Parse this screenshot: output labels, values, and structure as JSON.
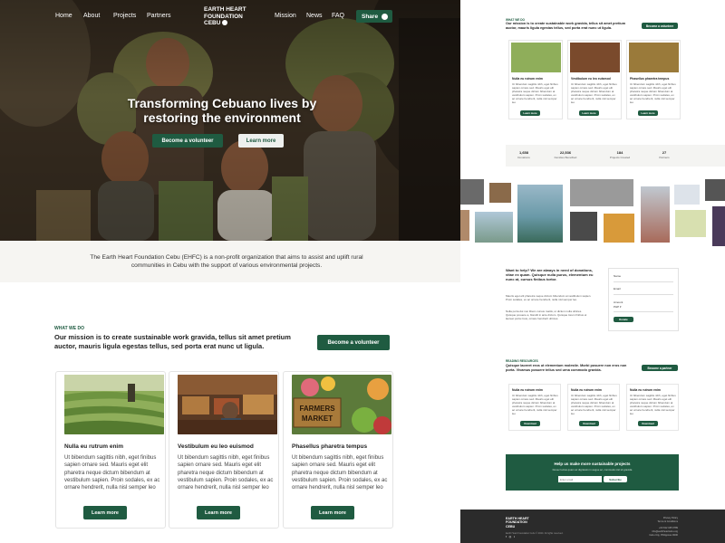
{
  "colors": {
    "brand_green": "#1f5b41",
    "footer_bg": "#2b2b2b",
    "about_bg": "#f6f5f2"
  },
  "nav": {
    "items": [
      "Home",
      "About",
      "Projects",
      "Partners",
      "Mission",
      "News",
      "FAQ"
    ],
    "logo": [
      "EARTH HEART",
      "FOUNDATION",
      "CEBU"
    ],
    "share": "Share",
    "share_icon": "share-icon"
  },
  "hero": {
    "title": "Transforming Cebuano lives by restoring the environment",
    "volunteer": "Become a volunteer",
    "learn": "Learn more"
  },
  "about": {
    "text": "The Earth Heart Foundation Cebu (EHFC) is a non-profit organization that aims to assist and uplift rural communities in Cebu with the support of various environmental projects."
  },
  "what_we_do": {
    "label": "WHAT WE DO",
    "title": "Our mission is to create sustainable work gravida, tellus sit amet pretium auctor, mauris ligula egestas tellus, sed porta erat nunc ut ligula.",
    "button": "Become a volunteer"
  },
  "cards": [
    {
      "title": "Nulla eu rutrum enim",
      "body": "Ut bibendum sagittis nibh, eget finibus sapien ornare sed. Mauris eget elit pharetra neque dictum bibendum at vestibulum sapien. Proin sodales, ex ac ornare hendrerit, nulla nisl semper leo",
      "button": "Learn more"
    },
    {
      "title": "Vestibulum eu leo euismod",
      "body": "Ut bibendum sagittis nibh, eget finibus sapien ornare sed. Mauris eget elit pharetra neque dictum bibendum at vestibulum sapien. Proin sodales, ex ac ornare hendrerit, nulla nisl semper leo",
      "button": "Learn more"
    },
    {
      "title": "Phasellus pharetra tempus",
      "body": "Ut bibendum sagittis nibh, eget finibus sapien ornare sed. Mauris eget elit pharetra neque dictum bibendum at vestibulum sapien. Proin sodales, ex ac ornare hendrerit, nulla nisl semper leo",
      "button": "Learn more",
      "sign": [
        "FARMERS",
        "MARKET"
      ]
    }
  ],
  "right": {
    "wwd_label": "WHAT WE DO",
    "wwd_title": "Our mission is to create sustainable work gravida, tellus sit amet pretium auctor, mauris ligula egestas tellus, sed porta erat nunc ut ligula.",
    "wwd_button": "Become a volunteer",
    "cards": [
      {
        "title": "Nulla eu rutrum enim",
        "body": "Ut bibendum sagittis nibh, eget finibus sapien ornare sed. Mauris eget elit pharetra neque dictum bibendum at vestibulum sapien. Proin sodales, ex ac ornare hendrerit, nulla nisl semper leo",
        "button": "Learn more"
      },
      {
        "title": "Vestibulum eu leo euismod",
        "body": "Ut bibendum sagittis nibh, eget finibus sapien ornare sed. Mauris eget elit pharetra neque dictum bibendum at vestibulum sapien. Proin sodales, ex ac ornare hendrerit, nulla nisl semper leo",
        "button": "Learn more"
      },
      {
        "title": "Phasellus pharetra tempus",
        "body": "Ut bibendum sagittis nibh, eget finibus sapien ornare sed. Mauris eget elit pharetra neque dictum bibendum at vestibulum sapien. Proin sodales, ex ac ornare hendrerit, nulla nisl semper leo",
        "button": "Learn more"
      }
    ],
    "stats": [
      {
        "value": "1,658",
        "label": "Donations"
      },
      {
        "value": "22,536",
        "label": "Families Benefited"
      },
      {
        "value": "184",
        "label": "Projects Created"
      },
      {
        "value": "27",
        "label": "Partners"
      }
    ],
    "help": {
      "title": "Want to help? We are always in need of donations, vitae ex quam. Quisque nulla purus, elementum eu nunc at, cursus finibus tortor.",
      "p1": "Mauris eget elit pharetra neque dictum bibendum at vestibulum sapien. Proin sodales, ex ac ornare hendrerit, nulla nisl semper leo.",
      "p2": "Nulla porta dui non libero cursus mattis, ut dictum nulla ultrices. Quisque posuere a, blandit in ante dictum. Quisque lorem finibus et laoreet porta risus, ornare hendrerit ultrices."
    },
    "form": {
      "name_label": "Name",
      "email_label": "Email",
      "amount_label": "Amount",
      "currency": "PHP",
      "donate": "Donate"
    },
    "resources": {
      "label": "READING RESOURCES",
      "title": "Quisque laoreet eros ut elementum molestie. Morbi posuere non eros non porta. Vivamus posuere tellus sed urna commodo gravida.",
      "button": "Become a partner",
      "cards": [
        {
          "title": "Nulla eu rutrum enim",
          "body": "Ut bibendum sagittis nibh, eget finibus sapien ornare sed. Mauris eget elit pharetra neque dictum bibendum at vestibulum sapien. Proin sodales, ex ac ornare hendrerit, nulla nisl semper leo",
          "button": "Download"
        },
        {
          "title": "Nulla eu rutrum enim",
          "body": "Ut bibendum sagittis nibh, eget finibus sapien ornare sed. Mauris eget elit pharetra neque dictum bibendum at vestibulum sapien. Proin sodales, ex ac ornare hendrerit, nulla nisl semper leo",
          "button": "Download"
        },
        {
          "title": "Nulla eu rutrum enim",
          "body": "Ut bibendum sagittis nibh, eget finibus sapien ornare sed. Mauris eget elit pharetra neque dictum bibendum at vestibulum sapien. Proin sodales, ex ac ornare hendrerit, nulla nisl semper leo",
          "button": "Download"
        }
      ]
    },
    "cta": {
      "title": "Help us make more sustainable projects",
      "sub": "Donec luctus quam ac dignissim in augue ac, commodo nisl sit gravida",
      "placeholder": "Enter email",
      "button": "Subscribe"
    },
    "footer": {
      "logo": [
        "EARTH HEART",
        "FOUNDATION",
        "CEBU"
      ],
      "copy": "Earth Heart Foundation Cebu © 2020. All rights reserved.",
      "links": [
        "Privacy Policy",
        "Terms & Conditions"
      ],
      "contact": [
        "+63 912 345 6789",
        "info@earthheartcebu.org",
        "Cebu City, Philippines 6000"
      ],
      "social": "f  ◎  t"
    }
  }
}
